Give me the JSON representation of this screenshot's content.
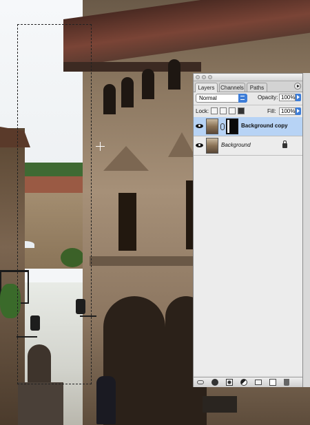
{
  "palette": {
    "tabs": [
      {
        "label": "Layers",
        "active": true
      },
      {
        "label": "Channels",
        "active": false
      },
      {
        "label": "Paths",
        "active": false
      }
    ],
    "blend_mode": "Normal",
    "opacity_label": "Opacity:",
    "opacity_value": "100%",
    "lock_label": "Lock:",
    "fill_label": "Fill:",
    "fill_value": "100%",
    "layers": [
      {
        "name": "Background copy",
        "selected": true,
        "visible": true,
        "has_mask": true
      },
      {
        "name": "Background",
        "selected": false,
        "visible": true,
        "locked": true
      }
    ],
    "lock_icons": [
      "lock-transparency-icon",
      "lock-image-icon",
      "lock-position-icon",
      "lock-all-icon"
    ],
    "bottom_icons": [
      "link-layers-icon",
      "layer-style-icon",
      "add-mask-icon",
      "adjustment-layer-icon",
      "new-group-icon",
      "new-layer-icon",
      "trash-icon"
    ]
  },
  "colors": {
    "selection_highlight": "#b7d3f5",
    "accent_blue": "#3d7dd8",
    "panel_bg": "#e8e8e8"
  }
}
